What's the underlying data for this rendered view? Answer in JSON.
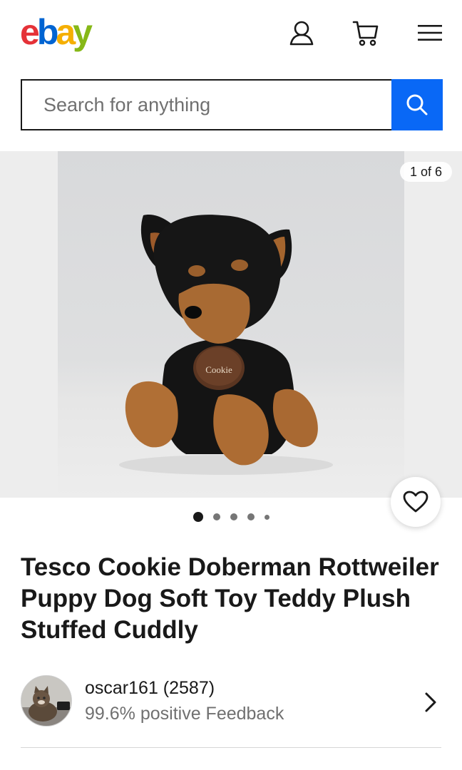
{
  "header": {
    "logo_letters": [
      "e",
      "b",
      "a",
      "y"
    ],
    "logo_colors": [
      "#e53238",
      "#0064d2",
      "#f5af02",
      "#86b817"
    ],
    "icons": [
      "account-icon",
      "cart-icon",
      "hamburger-menu-icon"
    ]
  },
  "search": {
    "placeholder": "Search for anything",
    "button_icon": "search-icon",
    "button_color": "#0968f6"
  },
  "gallery": {
    "counter": "1 of 6",
    "tag_text": "Cookie",
    "current_index": 1,
    "total_images": 6,
    "dots": 5,
    "favorite_icon": "heart-outline-icon"
  },
  "listing": {
    "title": "Tesco Cookie Doberman Rottweiler Puppy Dog Soft Toy Teddy Plush Stuffed Cuddly"
  },
  "seller": {
    "username": "oscar161",
    "feedback_count": "(2587)",
    "name_line": "oscar161 (2587)",
    "feedback_line": "99.6% positive Feedback",
    "arrow_icon": "chevron-right-icon"
  }
}
